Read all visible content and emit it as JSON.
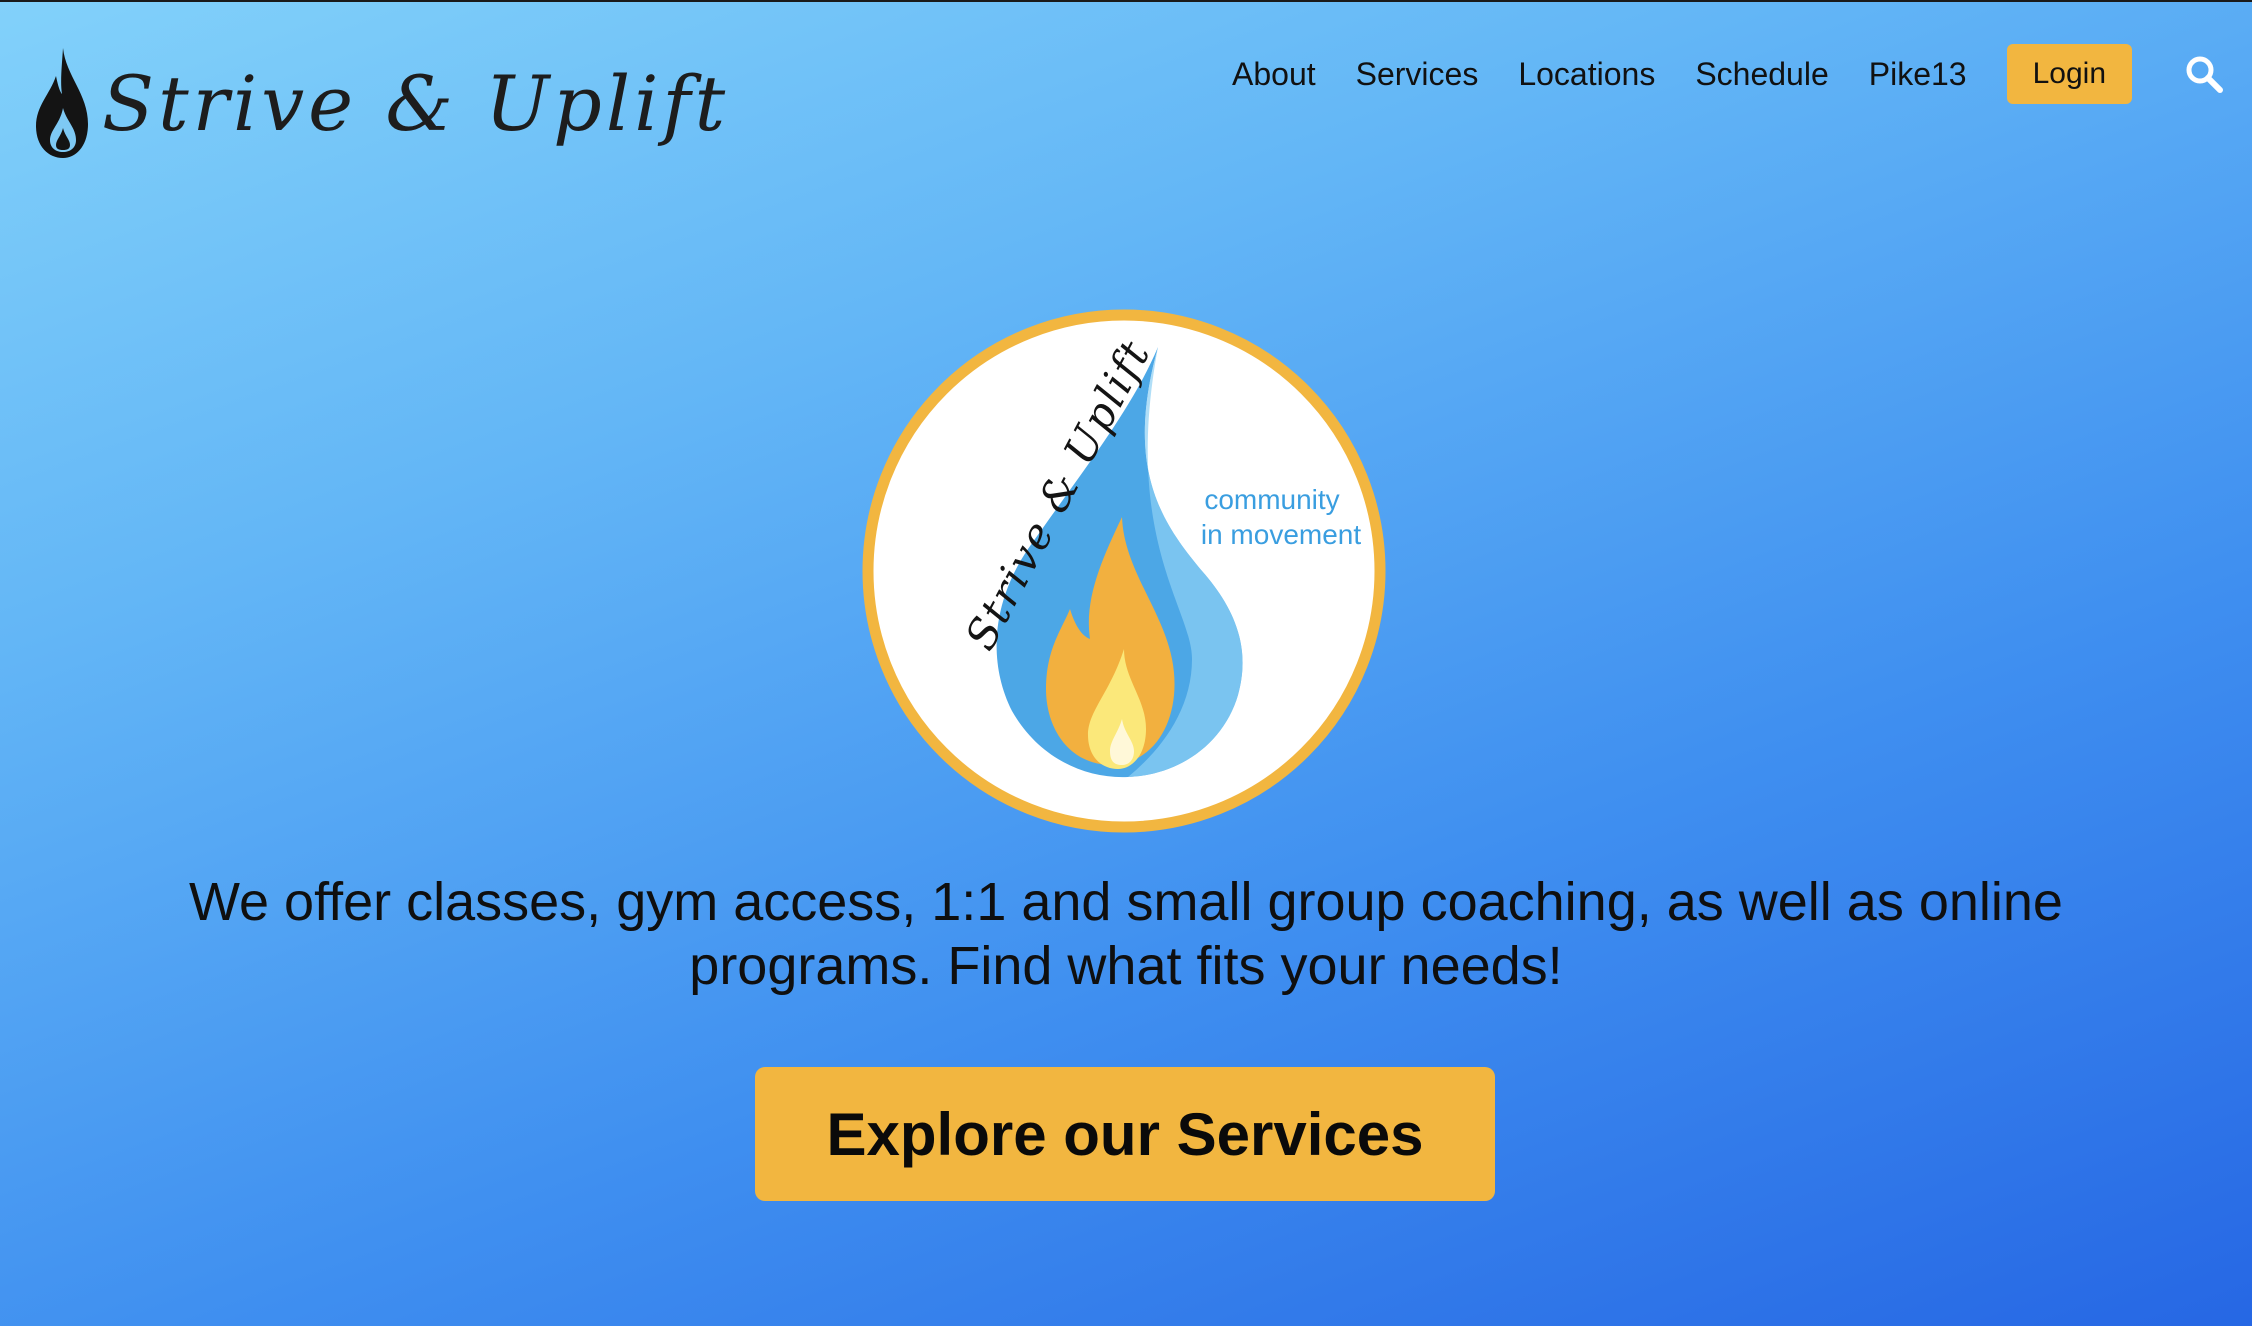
{
  "brand": {
    "logo_text": "Strive & Uplift",
    "emblem_text": "Strive & Uplift",
    "emblem_tagline_1": "community",
    "emblem_tagline_2": "in movement"
  },
  "nav": {
    "items": [
      {
        "label": "About"
      },
      {
        "label": "Services"
      },
      {
        "label": "Locations"
      },
      {
        "label": "Schedule"
      },
      {
        "label": "Pike13"
      }
    ],
    "login_label": "Login",
    "search_icon": "search-icon"
  },
  "hero": {
    "tagline": "We offer classes, gym access, 1:1 and small group coaching, as well as online programs. Find what fits your needs!",
    "cta_label": "Explore our Services"
  },
  "colors": {
    "accent": "#f2b640",
    "gradient_top": "#82d1fa",
    "gradient_bottom": "#2667e4",
    "emblem_blue": "#4ca7e6",
    "emblem_text_blue": "#3a9ee0",
    "flame_orange": "#f2b03f",
    "flame_yellow": "#fbe87a"
  }
}
